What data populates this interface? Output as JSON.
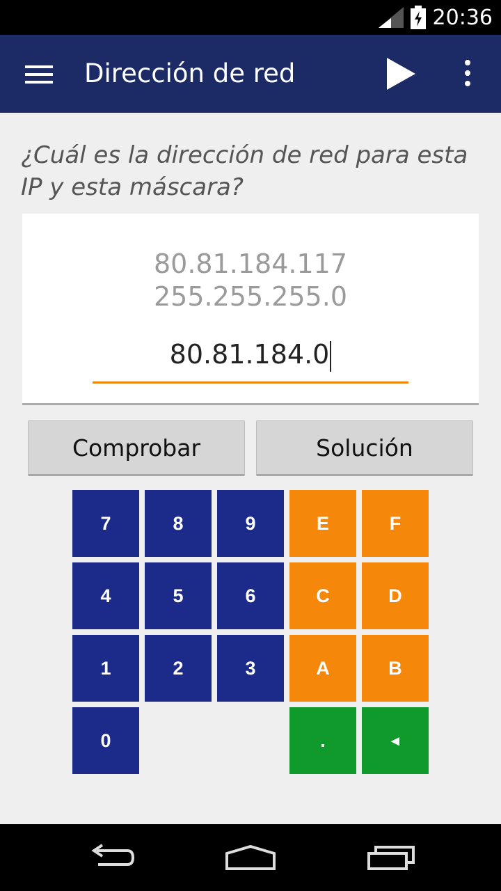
{
  "status_bar": {
    "time": "20:36",
    "icons": [
      "signal-icon",
      "battery-charging-icon"
    ]
  },
  "app_bar": {
    "title": "Dirección de red",
    "icons": [
      "menu-icon",
      "play-icon",
      "overflow-menu-icon"
    ]
  },
  "question": "¿Cuál es la dirección de red para esta IP y esta máscara?",
  "card": {
    "ip": "80.81.184.117",
    "mask": "255.255.255.0",
    "answer_value": "80.81.184.0"
  },
  "buttons": {
    "check_label": "Comprobar",
    "solution_label": "Solución"
  },
  "keypad": {
    "keys": [
      "7",
      "8",
      "9",
      "E",
      "F",
      "4",
      "5",
      "6",
      "C",
      "D",
      "1",
      "2",
      "3",
      "A",
      "B",
      "0",
      ".",
      "◂"
    ]
  },
  "nav_bar": {
    "icons": [
      "back-icon",
      "home-icon",
      "recents-icon"
    ]
  },
  "colors": {
    "app_bar": "#1c2b66",
    "key_blue": "#1c2b8a",
    "key_orange": "#f5870a",
    "key_green": "#0f9a2b",
    "input_underline": "#e8860c"
  }
}
